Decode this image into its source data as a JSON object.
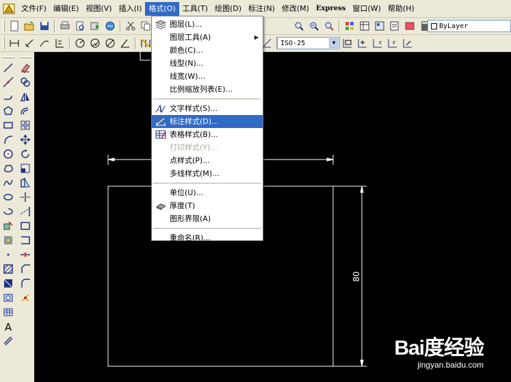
{
  "menubar": {
    "items": [
      {
        "label": "文件(F)"
      },
      {
        "label": "编辑(E)"
      },
      {
        "label": "视图(V)"
      },
      {
        "label": "插入(I)"
      },
      {
        "label": "格式(O)",
        "active": true
      },
      {
        "label": "工具(T)"
      },
      {
        "label": "绘图(D)"
      },
      {
        "label": "标注(N)"
      },
      {
        "label": "修改(M)"
      },
      {
        "label": "Express"
      },
      {
        "label": "窗口(W)"
      },
      {
        "label": "帮助(H)"
      }
    ]
  },
  "format_menu": {
    "items": [
      {
        "label": "图层(L)...",
        "icon": "layers-icon"
      },
      {
        "label": "图层工具(A)",
        "submenu": true
      },
      {
        "label": "颜色(C)..."
      },
      {
        "label": "线型(N)..."
      },
      {
        "label": "线宽(W)..."
      },
      {
        "label": "比例缩放列表(E)..."
      },
      {
        "label": "文字样式(S)...",
        "icon": "text-style-icon"
      },
      {
        "label": "标注样式(D)...",
        "icon": "dimension-style-icon",
        "highlight": true
      },
      {
        "label": "表格样式(B)...",
        "icon": "table-style-icon"
      },
      {
        "label": "打印样式(Y)...",
        "disabled": true
      },
      {
        "label": "点样式(P)..."
      },
      {
        "label": "多线样式(M)..."
      },
      {
        "label": "单位(U)..."
      },
      {
        "label": "厚度(T)",
        "icon": "thickness-icon"
      },
      {
        "label": "图形界限(A)"
      },
      {
        "label": "重命名(R)..."
      }
    ]
  },
  "toolbar": {
    "layer_value": "ByLayer",
    "dimstyle_value": "ISO-25"
  },
  "drawing": {
    "dimension_text": "80"
  },
  "watermark": {
    "logo": "Bai度经验",
    "url": "jingyan.baidu.com"
  },
  "colors": {
    "accent": "#316ac5",
    "canvas": "#000000",
    "chrome": "#ece9d8"
  }
}
